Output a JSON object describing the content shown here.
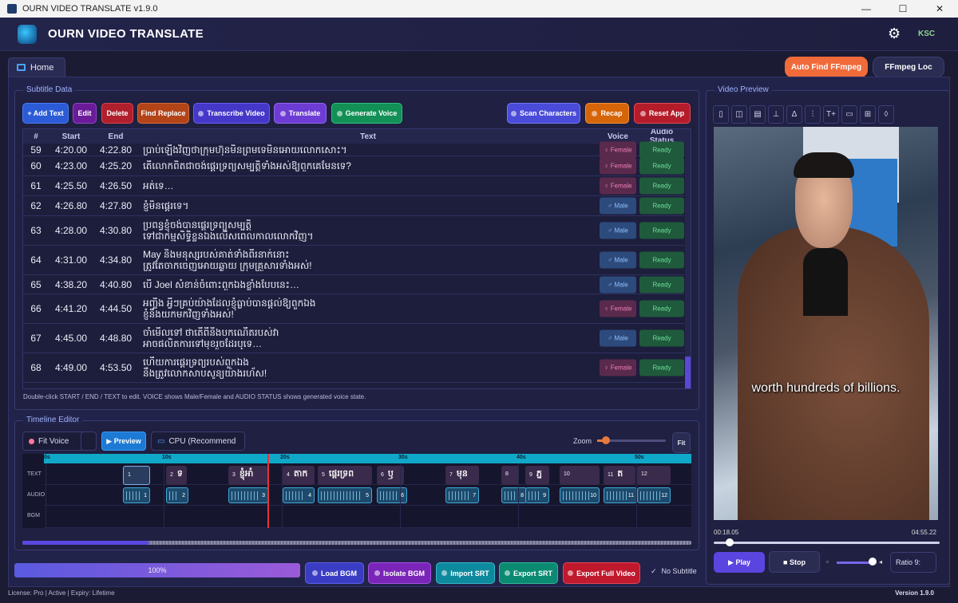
{
  "window": {
    "title": "OURN VIDEO TRANSLATE v1.9.0",
    "min": "—",
    "max": "☐",
    "close": "✕"
  },
  "header": {
    "app_title": "OURN VIDEO TRANSLATE",
    "user": "KSC"
  },
  "tabs": {
    "home": "Home"
  },
  "top_buttons": {
    "auto_find": "Auto Find FFmpeg",
    "ffmpeg_loc": "FFmpeg Loc"
  },
  "subtitle": {
    "panel_label": "Subtitle Data",
    "buttons": {
      "add": "+ Add Text",
      "edit": "Edit",
      "delete": "Delete",
      "find": "Find Replace",
      "transcribe": "Transcribe Video",
      "translate": "Translate",
      "generate": "Generate Voice",
      "scan": "Scan Characters",
      "recap": "Recap",
      "reset": "Reset App"
    },
    "columns": {
      "num": "#",
      "start": "Start",
      "end": "End",
      "text": "Text",
      "voice": "Voice",
      "status": "Audio Status"
    },
    "rows": [
      {
        "num": "59",
        "start": "4:20.00",
        "end": "4:22.80",
        "text": "ប្រាប់ឡើងវិញថាក្រុមហ៊ុនមិនព្រមទេមិនអោយលោកសោះ។",
        "voice": "♀ Female",
        "status": "Ready"
      },
      {
        "num": "60",
        "start": "4:23.00",
        "end": "4:25.20",
        "text": "តើលោកពិតជាចង់ផ្ដេរទ្រព្យសម្បត្តិទាំងអស់ឱ្យពួកគេមែនទេ?",
        "voice": "♀ Female",
        "status": "Ready"
      },
      {
        "num": "61",
        "start": "4:25.50",
        "end": "4:26.50",
        "text": "អត់ទេ…",
        "voice": "♀ Female",
        "status": "Ready"
      },
      {
        "num": "62",
        "start": "4:26.80",
        "end": "4:27.80",
        "text": "ខ្ញុំមិនផ្ដេរទេ។",
        "voice": "♂ Male",
        "status": "Ready"
      },
      {
        "num": "63",
        "start": "4:28.00",
        "end": "4:30.80",
        "text": "ប្រពន្ធខ្ញុំចង់បានផ្ដេរទ្រព្យសម្បត្តិ",
        "text2": "ទៅជាកម្មសិទ្ធិខ្លួនឯងលើសពេលកាលលោកវិញ។",
        "voice": "♂ Male",
        "status": "Ready"
      },
      {
        "num": "64",
        "start": "4:31.00",
        "end": "4:34.80",
        "text": "May និងមនុស្សរបស់គាត់ទាំងពីរនាក់នោះ",
        "text2": "ត្រូវតែចាកចេញអោយឆ្ងាយ ក្រុមគ្រួសារទាំងអស់!",
        "voice": "♂ Male",
        "status": "Ready"
      },
      {
        "num": "65",
        "start": "4:38.20",
        "end": "4:40.80",
        "text": "បើ Joel សំខាន់ចំពោះពួកឯងខ្លាំងបែបនេះ…",
        "voice": "♂ Male",
        "status": "Ready"
      },
      {
        "num": "66",
        "start": "4:41.20",
        "end": "4:44.50",
        "text": "អញ្ចឹង អ្វីៗគ្រប់យ៉ាងដែលខ្ញុំធ្លាប់បានផ្ដល់ឱ្យពួកឯង",
        "text2": "ខ្ញុំនឹងយកមកវិញទាំងអស់!",
        "voice": "♀ Female",
        "status": "Ready"
      },
      {
        "num": "67",
        "start": "4:45.00",
        "end": "4:48.80",
        "text": "ចាំមើលទៅ ថាតើពីនឹងបកណើតរបស់វា",
        "text2": "អាចផលិតការទៅមុខរួចដែរឬទេ…",
        "voice": "♂ Male",
        "status": "Ready"
      },
      {
        "num": "68",
        "start": "4:49.00",
        "end": "4:53.50",
        "text": "ហើយការផ្ដេរទ្រព្យរបស់ពួកឯង",
        "text2": "នឹងត្រូវលោកសាបសូន្យយ៉ាងរហ័ស!",
        "voice": "♀ Female",
        "status": "Ready"
      }
    ],
    "hint": "Double-click START / END / TEXT to edit. VOICE shows Male/Female and AUDIO STATUS shows generated voice state."
  },
  "timeline": {
    "panel_label": "Timeline Editor",
    "fit_voice": "Fit Voice",
    "preview": "▶ Preview",
    "cpu": "CPU (Recommend",
    "zoom": "Zoom",
    "fit": "Fit",
    "ticks": [
      "0s",
      "10s",
      "20s",
      "30s",
      "40s",
      "50s"
    ],
    "lanes": [
      "TEXT",
      "AUDIO",
      "BGM"
    ],
    "clips": [
      {
        "n": "1",
        "g": ""
      },
      {
        "n": "2",
        "g": "ទ"
      },
      {
        "n": "3",
        "g": "ខ្ញុំអាំ"
      },
      {
        "n": "4",
        "g": "តាក"
      },
      {
        "n": "5",
        "g": "ផ្ដេរទ្រព"
      },
      {
        "n": "6",
        "g": "ឫ"
      },
      {
        "n": "7",
        "g": "មុន"
      },
      {
        "n": "8",
        "g": ""
      },
      {
        "n": "9",
        "g": "ភ្ន"
      },
      {
        "n": "10",
        "g": ""
      },
      {
        "n": "11",
        "g": "ត"
      },
      {
        "n": "12",
        "g": ""
      }
    ]
  },
  "bottom": {
    "progress": "100%",
    "load_bgm": "Load BGM",
    "isolate_bgm": "Isolate BGM",
    "import_srt": "Import SRT",
    "export_srt": "Export SRT",
    "export_full": "Export Full Video",
    "no_subtitle": "No Subtitle",
    "no_subtitle_check": "✓"
  },
  "status": {
    "license": "License: Pro | Active | Expiry: Lifetime",
    "version": "Version 1.9.0"
  },
  "video": {
    "panel_label": "Video Preview",
    "caption": "worth hundreds of billions.",
    "current": "00:18.05",
    "total": "04:55.22",
    "play": "▶ Play",
    "stop": "■ Stop",
    "ratio": "Ratio 9:",
    "tools": [
      "▯",
      "◫",
      "▤",
      "⊥",
      "Δ",
      "⫶",
      "T+",
      "▭",
      "⊞",
      "◊"
    ]
  },
  "colors": {
    "accent": "#5b45e0",
    "ready": "#6fe09c",
    "female": "#ef7fb8",
    "male": "#8ec0ff",
    "playhead": "#e0363b"
  }
}
